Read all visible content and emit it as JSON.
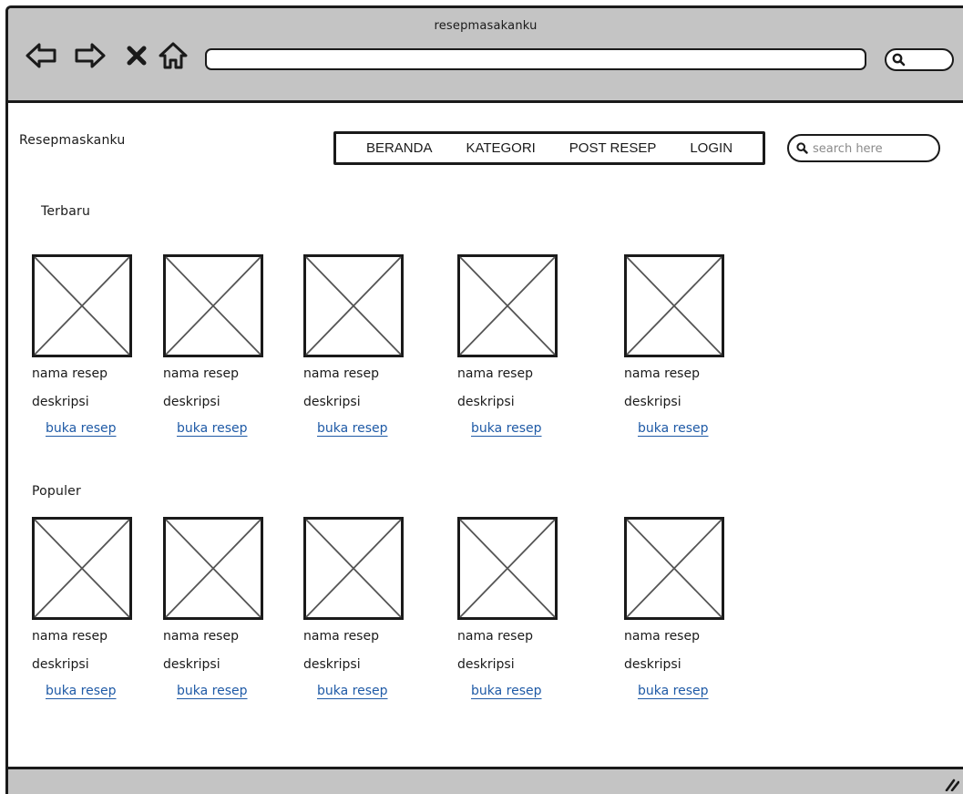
{
  "window": {
    "title": "resepmasakanku",
    "address_value": "",
    "icons": [
      "back-arrow-icon",
      "forward-arrow-icon",
      "stop-icon",
      "home-icon",
      "search-icon",
      "resize-grip-icon"
    ]
  },
  "site": {
    "title": "Resepmaskanku"
  },
  "nav": {
    "items": [
      {
        "label": "BERANDA"
      },
      {
        "label": "KATEGORI"
      },
      {
        "label": "POST RESEP"
      },
      {
        "label": "LOGIN"
      }
    ]
  },
  "search": {
    "placeholder": "search here"
  },
  "sections": [
    {
      "heading": "Terbaru",
      "cards": [
        {
          "name": "nama resep",
          "description": "deskripsi",
          "link": "buka resep"
        },
        {
          "name": "nama resep",
          "description": "deskripsi",
          "link": "buka resep"
        },
        {
          "name": "nama resep",
          "description": "deskripsi",
          "link": "buka resep"
        },
        {
          "name": "nama resep",
          "description": "deskripsi",
          "link": "buka resep"
        },
        {
          "name": "nama resep",
          "description": "deskripsi",
          "link": "buka resep"
        }
      ]
    },
    {
      "heading": "Populer",
      "cards": [
        {
          "name": "nama resep",
          "description": "deskripsi",
          "link": "buka resep"
        },
        {
          "name": "nama resep",
          "description": "deskripsi",
          "link": "buka resep"
        },
        {
          "name": "nama resep",
          "description": "deskripsi",
          "link": "buka resep"
        },
        {
          "name": "nama resep",
          "description": "deskripsi",
          "link": "buka resep"
        },
        {
          "name": "nama resep",
          "description": "deskripsi",
          "link": "buka resep"
        }
      ]
    }
  ],
  "colors": {
    "chrome": "#c4c4c4",
    "stroke": "#1a1a1a",
    "link": "#1f5aa6",
    "placeholder_x": "#555555"
  }
}
